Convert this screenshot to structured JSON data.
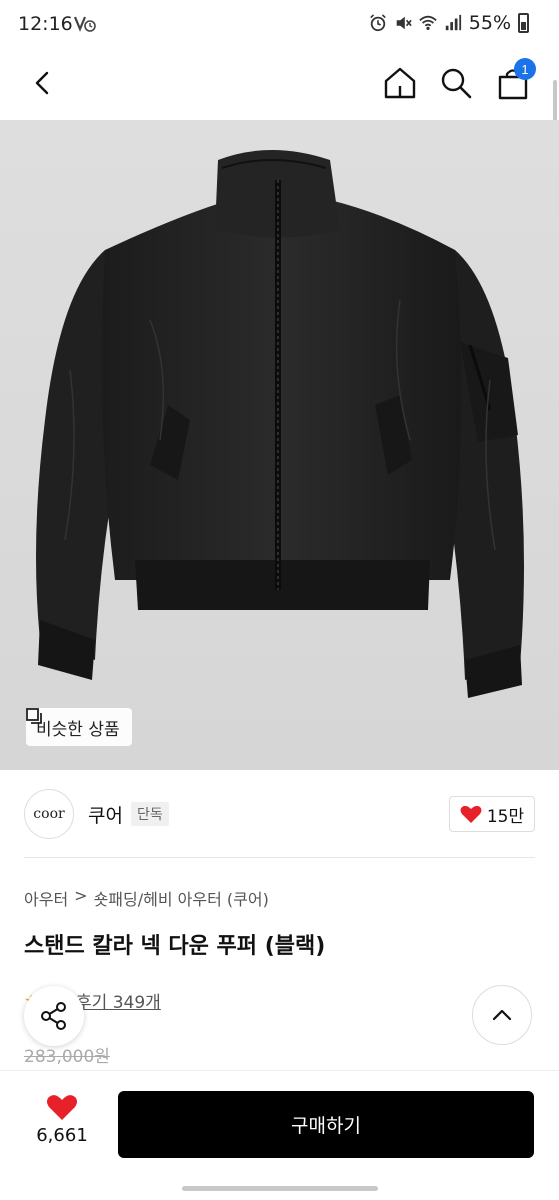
{
  "status_bar": {
    "time": "12:16",
    "left_icons": "V̸ ⏰",
    "battery": "55%"
  },
  "nav": {
    "cart_count": "1",
    "icons": [
      "chevron-left-icon",
      "home-icon",
      "search-icon",
      "shopping-bag-icon"
    ]
  },
  "image": {
    "similar_label": "비슷한 상품"
  },
  "brand": {
    "logo_text": "coor",
    "name": "쿠어",
    "badge": "단독",
    "likes": "15만"
  },
  "breadcrumb": {
    "level1": "아우터",
    "separator": ">",
    "level2": "숏패딩/헤비 아우터 (쿠어)"
  },
  "product": {
    "title": "스탠드 칼라 넥 다운 푸퍼 (블랙)",
    "review_label": "후기 349개",
    "original_price": "283,000원"
  },
  "bottom": {
    "wish_count": "6,661",
    "buy_label": "구매하기"
  },
  "colors": {
    "accent_badge": "#1a73e8",
    "heart": "#e8202a",
    "buy_button": "#000000"
  }
}
